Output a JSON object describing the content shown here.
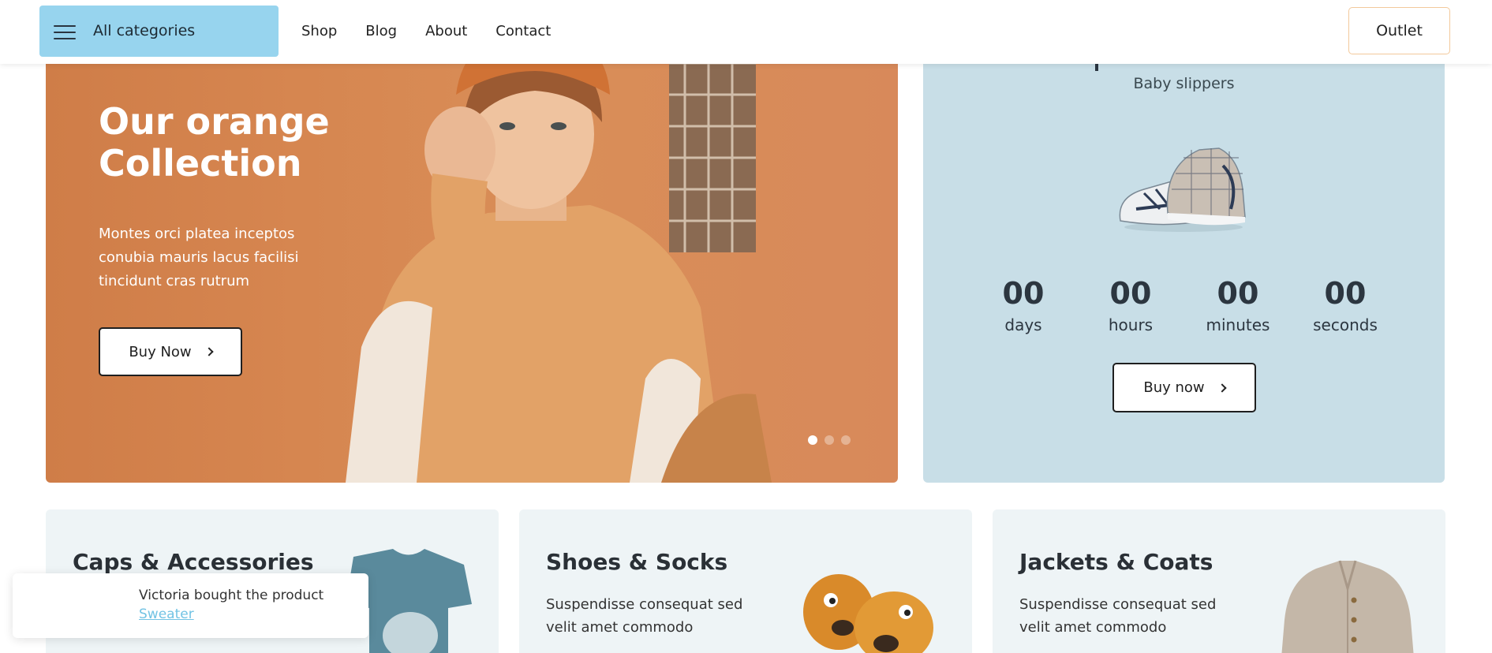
{
  "header": {
    "all_categories": "All categories",
    "nav": [
      "Shop",
      "Blog",
      "About",
      "Contact"
    ],
    "outlet": "Outlet"
  },
  "hero": {
    "title": "Our orange Collection",
    "text": "Montes orci platea inceptos conubia mauris lacus facilisi tincidunt cras rutrum",
    "button": "Buy Now",
    "slides": 3,
    "active_slide": 1
  },
  "promo": {
    "subtitle": "Baby slippers",
    "countdown": [
      {
        "value": "00",
        "label": "days"
      },
      {
        "value": "00",
        "label": "hours"
      },
      {
        "value": "00",
        "label": "minutes"
      },
      {
        "value": "00",
        "label": "seconds"
      }
    ],
    "button": "Buy now"
  },
  "cards": [
    {
      "title": "Caps & Accessories",
      "text": ""
    },
    {
      "title": "Shoes & Socks",
      "text": "Suspendisse consequat sed velit amet commodo"
    },
    {
      "title": "Jackets & Coats",
      "text": "Suspendisse consequat sed velit amet commodo"
    }
  ],
  "toast": {
    "message": "Victoria bought the product",
    "product": "Sweater"
  },
  "colors": {
    "category_button": "#97d4ee",
    "hero_background": "#d68650",
    "promo_background": "#c8dee7",
    "card_background": "#eef4f6",
    "outlet_border": "#f3c99b",
    "link": "#72c3e4"
  }
}
